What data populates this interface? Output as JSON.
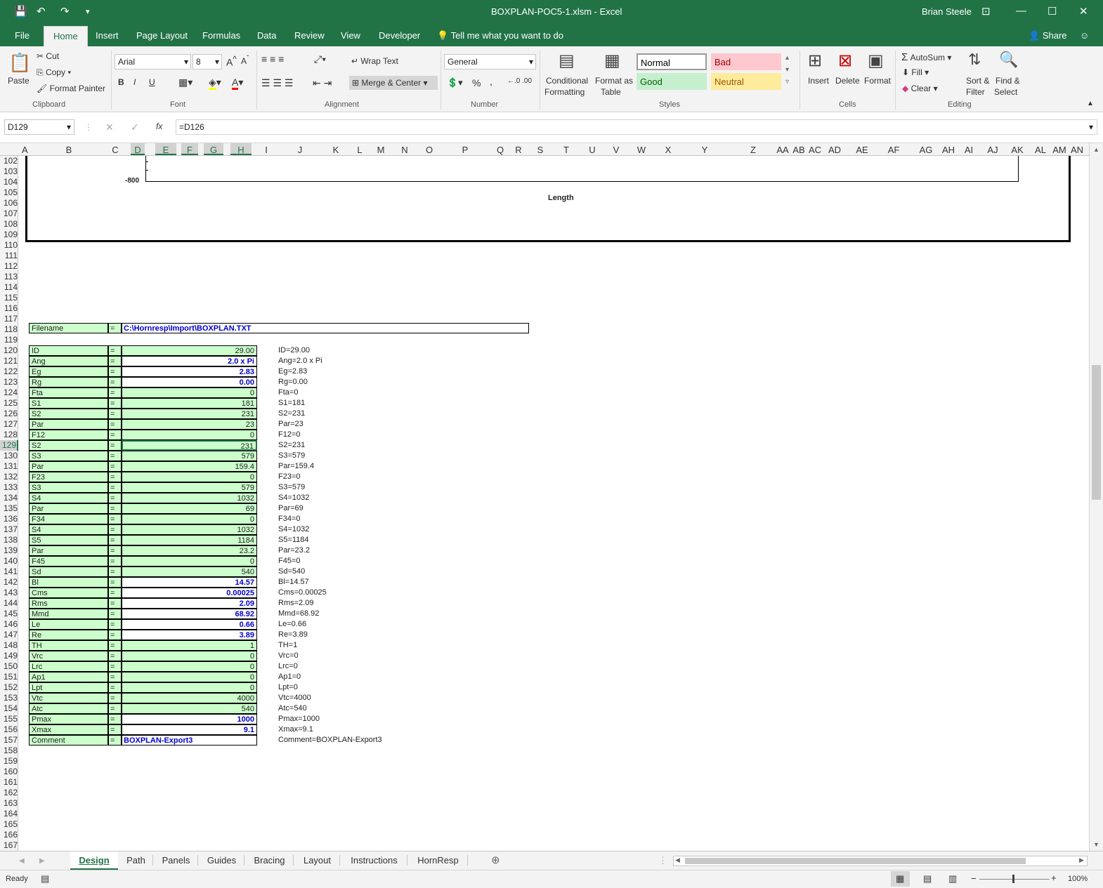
{
  "titlebar": {
    "title": "BOXPLAN-POC5-1.xlsm  -  Excel",
    "user": "Brian Steele"
  },
  "ribbon_tabs": [
    "File",
    "Home",
    "Insert",
    "Page Layout",
    "Formulas",
    "Data",
    "Review",
    "View",
    "Developer"
  ],
  "tell_me": "Tell me what you want to do",
  "share": "Share",
  "clipboard": {
    "paste": "Paste",
    "cut": "Cut",
    "copy": "Copy",
    "format_painter": "Format Painter",
    "label": "Clipboard"
  },
  "font": {
    "name": "Arial",
    "size": "8",
    "label": "Font",
    "bold": "B",
    "italic": "I",
    "underline": "U"
  },
  "alignment": {
    "wrap_text": "Wrap Text",
    "merge_center": "Merge & Center",
    "label": "Alignment"
  },
  "number": {
    "format": "General",
    "label": "Number",
    "percent": "%",
    "comma": ","
  },
  "styles": {
    "conditional": "Conditional",
    "conditional2": "Formatting",
    "format_as": "Format as",
    "format_as2": "Table",
    "normal": "Normal",
    "bad": "Bad",
    "good": "Good",
    "neutral": "Neutral",
    "label": "Styles"
  },
  "cells": {
    "insert": "Insert",
    "delete": "Delete",
    "format": "Format",
    "label": "Cells"
  },
  "editing": {
    "autosum": "AutoSum",
    "fill": "Fill",
    "clear": "Clear",
    "sort": "Sort &",
    "sort2": "Filter",
    "find": "Find &",
    "find2": "Select",
    "label": "Editing"
  },
  "formula_bar": {
    "name_box": "D129",
    "formula": "=D126",
    "fx": "fx"
  },
  "columns": [
    "A",
    "B",
    "C",
    "D",
    "E",
    "F",
    "G",
    "H",
    "I",
    "J",
    "K",
    "L",
    "M",
    "N",
    "O",
    "P",
    "Q",
    "R",
    "S",
    "T",
    "U",
    "V",
    "W",
    "X",
    "Y",
    "Z",
    "AA",
    "AB",
    "AC",
    "AD",
    "AE",
    "AF",
    "AG",
    "AH",
    "AI",
    "AJ",
    "AK",
    "AL",
    "AM",
    "AN"
  ],
  "rows": [
    "102",
    "103",
    "104",
    "105",
    "106",
    "107",
    "108",
    "109",
    "110",
    "111",
    "112",
    "113",
    "114",
    "115",
    "116",
    "117",
    "118",
    "119",
    "120",
    "121",
    "122",
    "123",
    "124",
    "125",
    "126",
    "127",
    "128",
    "129",
    "130",
    "131",
    "132",
    "133",
    "134",
    "135",
    "136",
    "137",
    "138",
    "139",
    "140",
    "141",
    "142",
    "143",
    "144",
    "145",
    "146",
    "147",
    "148",
    "149",
    "150",
    "151",
    "152",
    "153",
    "154",
    "155",
    "156",
    "157",
    "158",
    "159",
    "160",
    "161",
    "162",
    "163",
    "164",
    "165",
    "166",
    "167"
  ],
  "chart": {
    "ytick": "-800",
    "xlabel": "Length"
  },
  "filename": {
    "label": "Filename",
    "eq": "=",
    "value": "C:\\Hornresp\\Import\\BOXPLAN.TXT"
  },
  "params": [
    {
      "label": "ID",
      "value": "29.00",
      "out": "ID=29.00",
      "input": false
    },
    {
      "label": "Ang",
      "value": "2.0 x Pi",
      "out": "Ang=2.0 x Pi",
      "input": true
    },
    {
      "label": "Eg",
      "value": "2.83",
      "out": "Eg=2.83",
      "input": true
    },
    {
      "label": "Rg",
      "value": "0.00",
      "out": "Rg=0.00",
      "input": true
    },
    {
      "label": "Fta",
      "value": "0",
      "out": "Fta=0",
      "input": false
    },
    {
      "label": "S1",
      "value": "181",
      "out": "S1=181",
      "input": false
    },
    {
      "label": "S2",
      "value": "231",
      "out": "S2=231",
      "input": false
    },
    {
      "label": "Par",
      "value": "23",
      "out": "Par=23",
      "input": false
    },
    {
      "label": "F12",
      "value": "0",
      "out": "F12=0",
      "input": false
    },
    {
      "label": "S2",
      "value": "231",
      "out": "S2=231",
      "input": false
    },
    {
      "label": "S3",
      "value": "579",
      "out": "S3=579",
      "input": false
    },
    {
      "label": "Par",
      "value": "159.4",
      "out": "Par=159.4",
      "input": false
    },
    {
      "label": "F23",
      "value": "0",
      "out": "F23=0",
      "input": false
    },
    {
      "label": "S3",
      "value": "579",
      "out": "S3=579",
      "input": false
    },
    {
      "label": "S4",
      "value": "1032",
      "out": "S4=1032",
      "input": false
    },
    {
      "label": "Par",
      "value": "69",
      "out": "Par=69",
      "input": false
    },
    {
      "label": "F34",
      "value": "0",
      "out": "F34=0",
      "input": false
    },
    {
      "label": "S4",
      "value": "1032",
      "out": "S4=1032",
      "input": false
    },
    {
      "label": "S5",
      "value": "1184",
      "out": "S5=1184",
      "input": false
    },
    {
      "label": "Par",
      "value": "23.2",
      "out": "Par=23.2",
      "input": false
    },
    {
      "label": "F45",
      "value": "0",
      "out": "F45=0",
      "input": false
    },
    {
      "label": "Sd",
      "value": "540",
      "out": "Sd=540",
      "input": false
    },
    {
      "label": "Bl",
      "value": "14.57",
      "out": "Bl=14.57",
      "input": true
    },
    {
      "label": "Cms",
      "value": "0.00025",
      "out": "Cms=0.00025",
      "input": true
    },
    {
      "label": "Rms",
      "value": "2.09",
      "out": "Rms=2.09",
      "input": true
    },
    {
      "label": "Mmd",
      "value": "68.92",
      "out": "Mmd=68.92",
      "input": true
    },
    {
      "label": "Le",
      "value": "0.66",
      "out": "Le=0.66",
      "input": true
    },
    {
      "label": "Re",
      "value": "3.89",
      "out": "Re=3.89",
      "input": true
    },
    {
      "label": "TH",
      "value": "1",
      "out": "TH=1",
      "input": false
    },
    {
      "label": "Vrc",
      "value": "0",
      "out": "Vrc=0",
      "input": false
    },
    {
      "label": "Lrc",
      "value": "0",
      "out": "Lrc=0",
      "input": false
    },
    {
      "label": "Ap1",
      "value": "0",
      "out": "Ap1=0",
      "input": false
    },
    {
      "label": "Lpt",
      "value": "0",
      "out": "Lpt=0",
      "input": false
    },
    {
      "label": "Vtc",
      "value": "4000",
      "out": "Vtc=4000",
      "input": false
    },
    {
      "label": "Atc",
      "value": "540",
      "out": "Atc=540",
      "input": false
    },
    {
      "label": "Pmax",
      "value": "1000",
      "out": "Pmax=1000",
      "input": true
    },
    {
      "label": "Xmax",
      "value": "9.1",
      "out": "Xmax=9.1",
      "input": true
    },
    {
      "label": "Comment",
      "value": "BOXPLAN-Export3",
      "out": "Comment=BOXPLAN-Export3",
      "input": true
    }
  ],
  "sheet_tabs": [
    "Design",
    "Path",
    "Panels",
    "Guides",
    "Bracing",
    "Layout",
    "Instructions",
    "HornResp"
  ],
  "status": {
    "ready": "Ready",
    "zoom": "100%"
  },
  "colors": {
    "excel_green": "#217346",
    "label_fill": "#ccffcc",
    "input_blue": "#0000cc"
  }
}
